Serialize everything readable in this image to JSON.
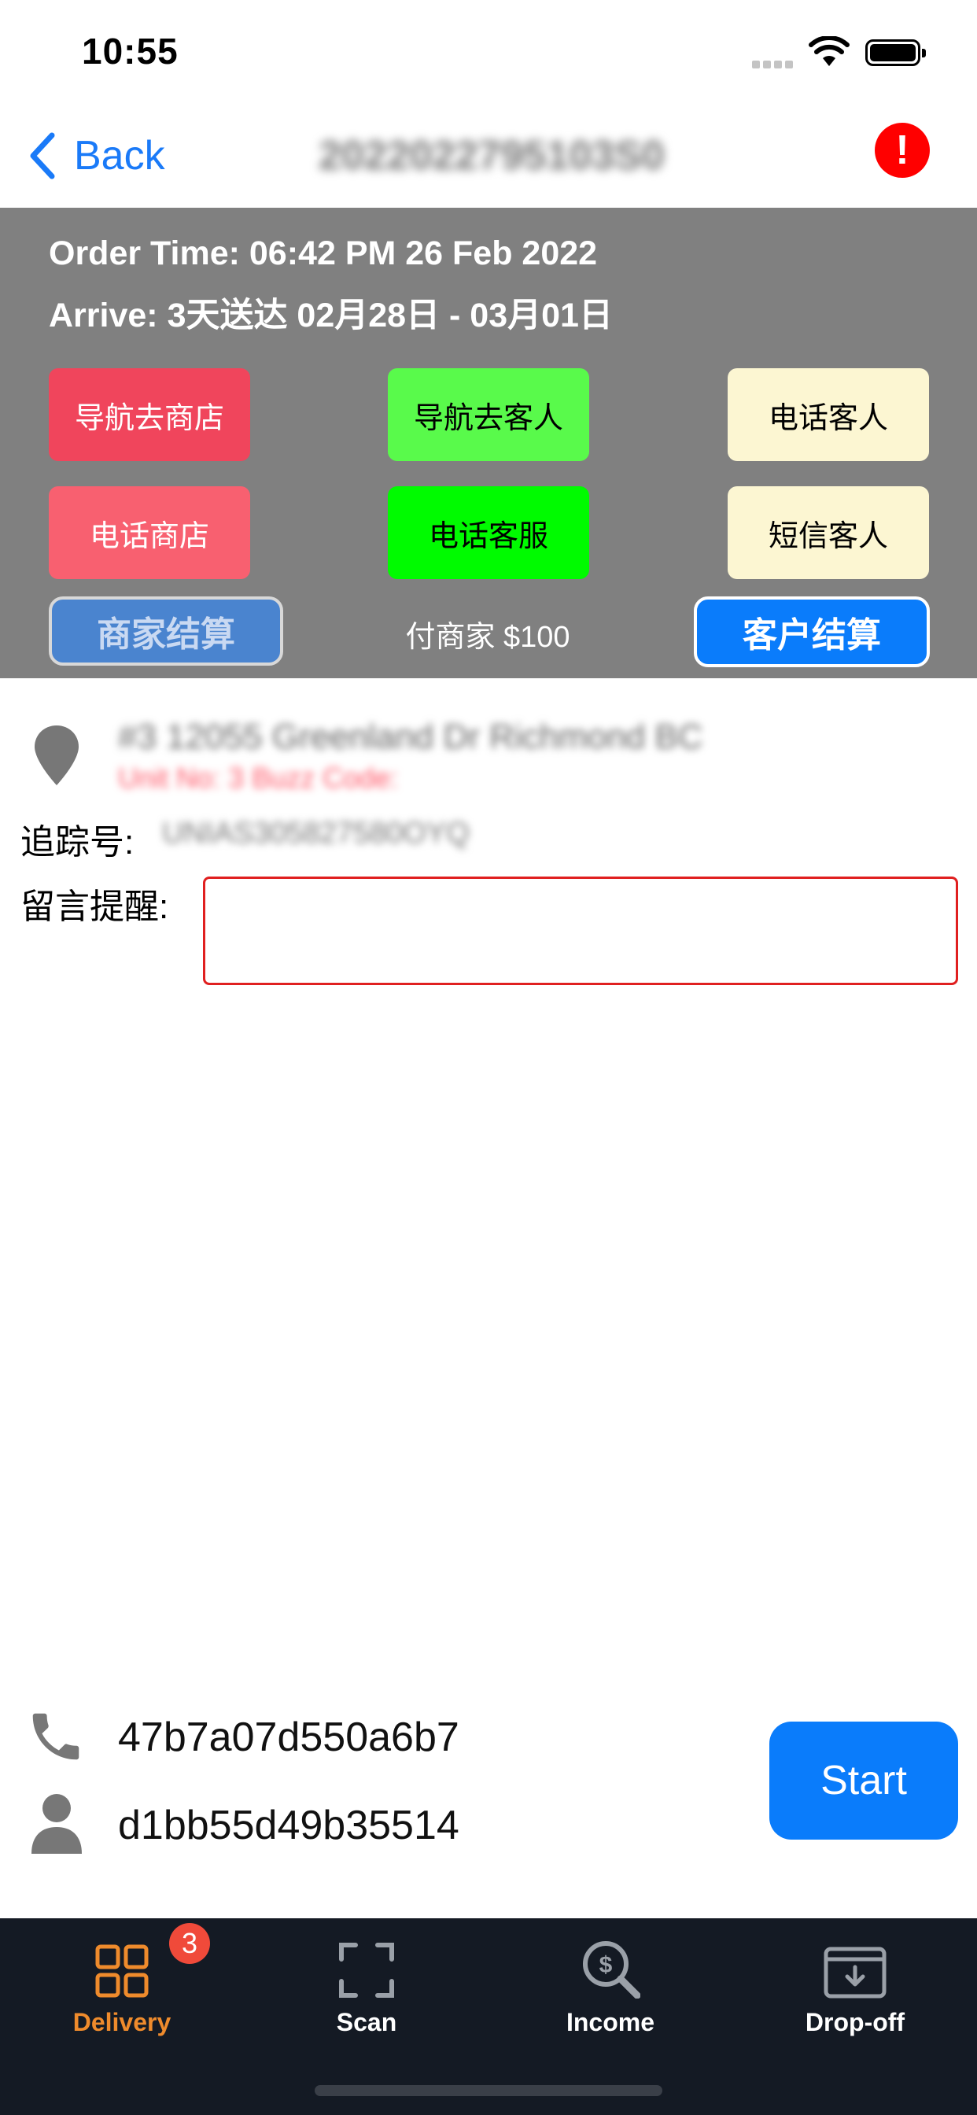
{
  "status_bar": {
    "time": "10:55"
  },
  "nav": {
    "back_label": "Back",
    "order_number": "2022022795103S0"
  },
  "order": {
    "order_time": "Order Time: 06:42 PM 26 Feb 2022",
    "arrive": "Arrive: 3天送达 02月28日 - 03月01日"
  },
  "actions": {
    "nav_to_store": "导航去商店",
    "nav_to_customer": "导航去客人",
    "call_customer": "电话客人",
    "call_store": "电话商店",
    "call_support": "电话客服",
    "sms_customer": "短信客人",
    "merchant_settle": "商家结算",
    "pay_merchant": "付商家 $100",
    "customer_settle": "客户结算"
  },
  "address": {
    "line1": "#3 12055 Greenland Dr Richmond BC",
    "line2": "Unit No:  3     Buzz Code:"
  },
  "tracking": {
    "label": "追踪号:",
    "value": "UNIAS305827580OYQ"
  },
  "note": {
    "label": "留言提醒:",
    "value": ""
  },
  "contact": {
    "phone": "47b7a07d550a6b7",
    "name": "d1bb55d49b35514"
  },
  "start_label": "Start",
  "tabs": [
    {
      "label": "Delivery",
      "icon": "grid-icon",
      "badge": "3",
      "active": true
    },
    {
      "label": "Scan",
      "icon": "scan-icon"
    },
    {
      "label": "Income",
      "icon": "income-search-icon"
    },
    {
      "label": "Drop-off",
      "icon": "dropoff-icon"
    }
  ],
  "colors": {
    "accent_blue": "#0a7cfb",
    "panel_grey": "#808080",
    "tab_active": "#ef8b2c",
    "tabbar_bg": "#141a24",
    "alert_red": "#ff0000"
  }
}
